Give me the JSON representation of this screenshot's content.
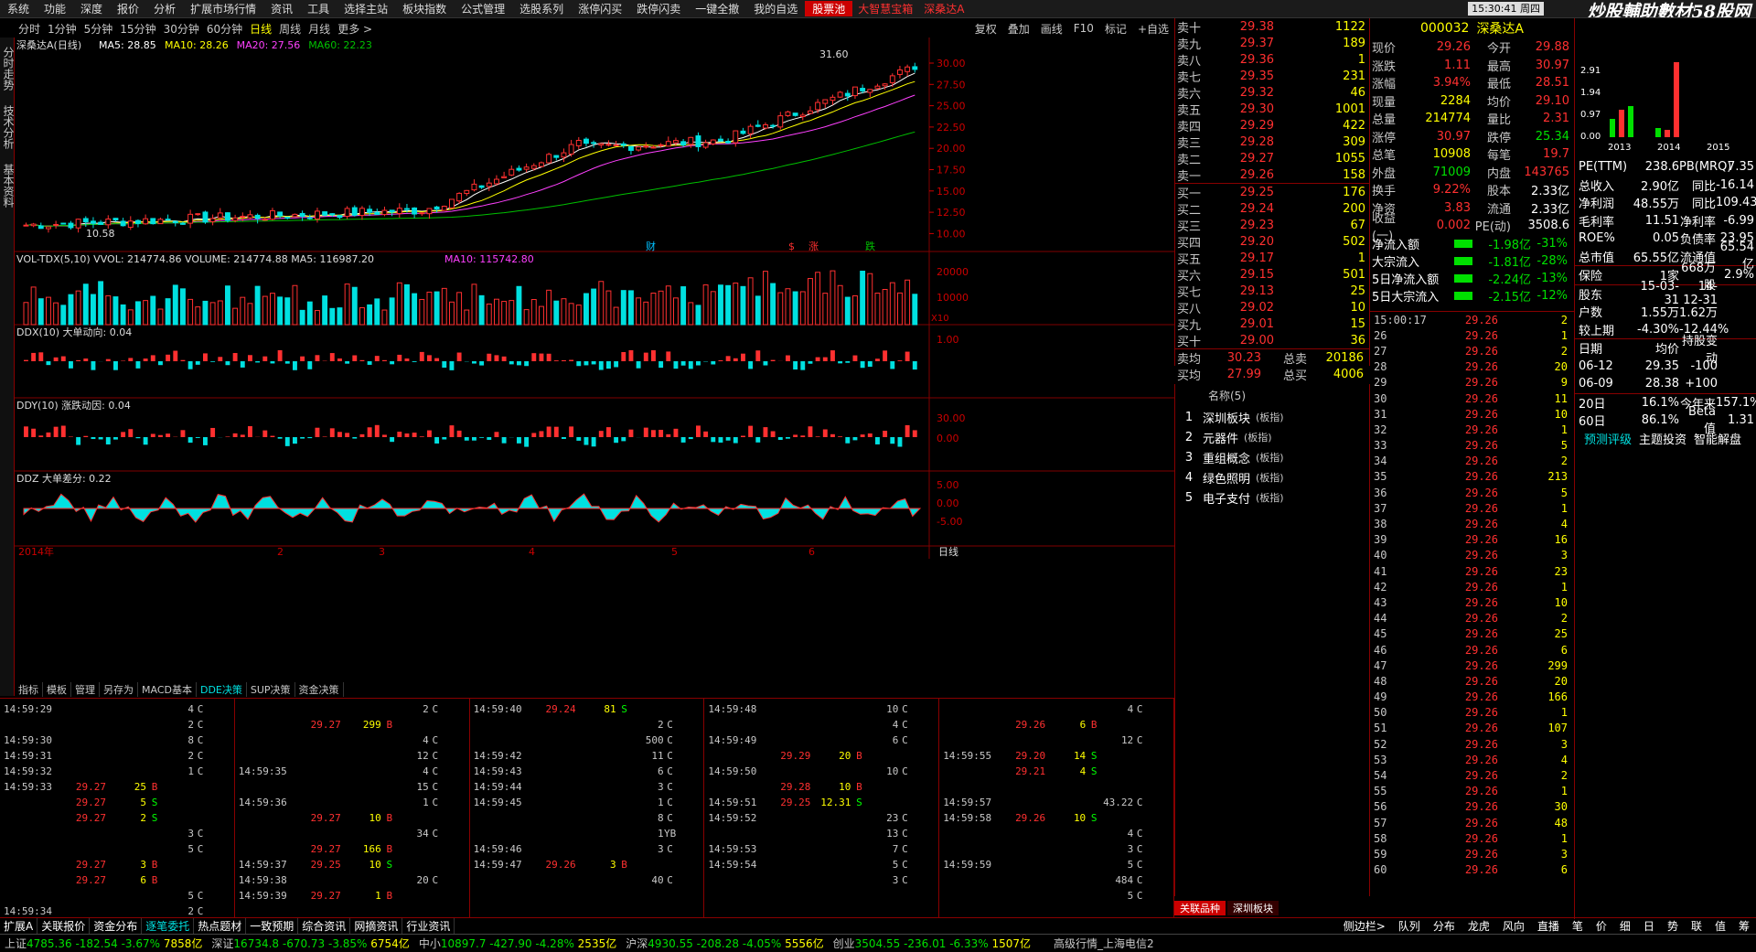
{
  "menu": {
    "items": [
      "系统",
      "功能",
      "深度",
      "报价",
      "分析",
      "扩展市场行情",
      "资讯",
      "工具",
      "选择主站",
      "板块指数",
      "公式管理",
      "选股系列",
      "涨停闪买",
      "跌停闪卖",
      "一键全撤",
      "我的自选",
      "股票池"
    ],
    "active": "股票池",
    "hot": [
      "大智慧宝箱",
      "深桑达A"
    ],
    "clock": "15:30:41 周四",
    "watermark": "炒股輔助數材58股网"
  },
  "periods": {
    "items": [
      "分时",
      "1分钟",
      "5分钟",
      "15分钟",
      "30分钟",
      "60分钟",
      "日线",
      "周线",
      "月线",
      "更多 >"
    ],
    "active": "日线",
    "tools": [
      "复权",
      "叠加",
      "画线",
      "F10",
      "标记",
      "+自选"
    ]
  },
  "sidebar": {
    "tabs": [
      "分时走势",
      "技术分析",
      "基本资料"
    ]
  },
  "chart": {
    "title": "深桑达A(日线)",
    "ma": [
      {
        "label": "MA5: 28.85",
        "color": "#ffffff"
      },
      {
        "label": "MA10: 28.26",
        "color": "#ffff00"
      },
      {
        "label": "MA20: 27.56",
        "color": "#ff40ff"
      },
      {
        "label": "MA60: 22.23",
        "color": "#00c000"
      }
    ],
    "high_label": "31.60",
    "low_label": "10.58",
    "price_ticks": [
      "30.00",
      "27.50",
      "25.00",
      "22.50",
      "20.00",
      "17.50",
      "15.00",
      "12.50",
      "10.00"
    ],
    "vol_title": "VOL-TDX(5,10) VVOL: 214774.86  VOLUME: 214774.88  MA5: 116987.20",
    "vol_ma10": "MA10: 115742.80",
    "vol_ticks": [
      "20000",
      "10000"
    ],
    "vol_unit": "X10",
    "ddx_title": "DDX(10) 大单动向: 0.04",
    "ddx_ticks": [
      "1.00"
    ],
    "ddy_title": "DDY(10) 涨跌动因: 0.04",
    "ddy_ticks": [
      "30.00",
      "0.00"
    ],
    "ddz_title": "DDZ 大单差分: 0.22",
    "ddz_ticks": [
      "5.00",
      "0.00",
      "-5.00"
    ],
    "date_labels": [
      "2014年",
      "2",
      "3",
      "4",
      "5",
      "6"
    ],
    "period_label": "日线",
    "markers": [
      "财",
      "$",
      "涨",
      "跌"
    ]
  },
  "chart_data": {
    "type": "candlestick",
    "series": [
      {
        "name": "MA5",
        "values": [
          28.85
        ]
      },
      {
        "name": "MA10",
        "values": [
          28.26
        ]
      },
      {
        "name": "MA20",
        "values": [
          27.56
        ]
      },
      {
        "name": "MA60",
        "values": [
          22.23
        ]
      }
    ],
    "ylim": [
      10,
      31.6
    ],
    "high": 31.6,
    "low": 10.58
  },
  "indicator_tabs": {
    "items": [
      "指标",
      "模板",
      "管理",
      "另存为",
      "MACD基本",
      "DDE决策",
      "SUP决策",
      "资金决策"
    ],
    "active": "DDE决策"
  },
  "ticks": [
    [
      [
        "14:59:29",
        "",
        "",
        "4",
        "C"
      ],
      [
        "",
        "",
        "",
        "2",
        "C"
      ],
      [
        "14:59:30",
        "",
        "",
        "8",
        "C"
      ],
      [
        "14:59:31",
        "",
        "",
        "2",
        "C"
      ],
      [
        "14:59:32",
        "",
        "",
        "1",
        "C"
      ],
      [
        "14:59:33",
        "29.27",
        "25",
        "B"
      ],
      [
        "",
        "29.27",
        "5",
        "S"
      ],
      [
        "",
        "29.27",
        "2",
        "S"
      ],
      [
        "",
        "",
        "",
        "3",
        "C"
      ],
      [
        "",
        "",
        "",
        "5",
        "C"
      ],
      [
        "",
        "29.27",
        "3",
        "B"
      ],
      [
        "",
        "29.27",
        "6",
        "B"
      ],
      [
        "",
        "",
        "",
        "5",
        "C"
      ],
      [
        "14:59:34",
        "",
        "",
        "2",
        "C"
      ]
    ],
    [
      [
        "",
        "",
        "",
        "2",
        "C"
      ],
      [
        "",
        "29.27",
        "299",
        "B"
      ],
      [
        "",
        "",
        "",
        "4",
        "C"
      ],
      [
        "",
        "",
        "",
        "12",
        "C"
      ],
      [
        "14:59:35",
        "",
        "",
        "4",
        "C"
      ],
      [
        "",
        "",
        "",
        "15",
        "C"
      ],
      [
        "14:59:36",
        "",
        "",
        "1",
        "C"
      ],
      [
        "",
        "29.27",
        "10",
        "B"
      ],
      [
        "",
        "",
        "",
        "34",
        "C"
      ],
      [
        "",
        "29.27",
        "166",
        "B"
      ],
      [
        "14:59:37",
        "29.25",
        "10",
        "S"
      ],
      [
        "14:59:38",
        "",
        "",
        "20",
        "C"
      ],
      [
        "14:59:39",
        "29.27",
        "1",
        "B"
      ],
      [
        "",
        "",
        "",
        ""
      ]
    ],
    [
      [
        "14:59:40",
        "29.24",
        "81",
        "S"
      ],
      [
        "",
        "",
        "",
        "2",
        "C"
      ],
      [
        "",
        "",
        "",
        "500",
        "C"
      ],
      [
        "14:59:42",
        "",
        "",
        "11",
        "C"
      ],
      [
        "14:59:43",
        "",
        "",
        "6",
        "C"
      ],
      [
        "14:59:44",
        "",
        "",
        "3",
        "C"
      ],
      [
        "14:59:45",
        "",
        "",
        "1",
        "C"
      ],
      [
        "",
        "",
        "",
        "8",
        "C"
      ],
      [
        "",
        "",
        "",
        "1",
        "YB"
      ],
      [
        "14:59:46",
        "",
        "",
        "3",
        "C"
      ],
      [
        "14:59:47",
        "29.26",
        "3",
        "B"
      ],
      [
        "",
        "",
        "",
        "40",
        "C"
      ],
      [
        "",
        "",
        "",
        ""
      ],
      [
        "",
        "",
        "",
        ""
      ]
    ],
    [
      [
        "14:59:48",
        "",
        "",
        "10",
        "C"
      ],
      [
        "",
        "",
        "",
        "4",
        "C"
      ],
      [
        "14:59:49",
        "",
        "",
        "6",
        "C"
      ],
      [
        "",
        "29.29",
        "20",
        "B"
      ],
      [
        "14:59:50",
        "",
        "",
        "10",
        "C"
      ],
      [
        "",
        "29.28",
        "10",
        "B"
      ],
      [
        "14:59:51",
        "29.25",
        "12.31",
        "S"
      ],
      [
        "14:59:52",
        "",
        "",
        "23",
        "C"
      ],
      [
        "",
        "",
        "",
        "13",
        "C"
      ],
      [
        "14:59:53",
        "",
        "",
        "7",
        "C"
      ],
      [
        "14:59:54",
        "",
        "",
        "5",
        "C"
      ],
      [
        "",
        "",
        "",
        "3",
        "C"
      ],
      [
        "",
        "",
        "",
        ""
      ],
      [
        "",
        "",
        "",
        ""
      ]
    ],
    [
      [
        "",
        "",
        "",
        "4",
        "C"
      ],
      [
        "",
        "29.26",
        "6",
        "B"
      ],
      [
        "",
        "",
        "",
        "12",
        "C"
      ],
      [
        "14:59:55",
        "29.20",
        "14",
        "S"
      ],
      [
        "",
        "29.21",
        "4",
        "S"
      ],
      [
        "",
        "",
        "",
        "",
        ""
      ],
      [
        "14:59:57",
        "",
        "",
        "43.22",
        "C"
      ],
      [
        "14:59:58",
        "29.26",
        "10",
        "S"
      ],
      [
        "",
        "",
        "",
        "4",
        "C"
      ],
      [
        "",
        "",
        "",
        "3",
        "C"
      ],
      [
        "14:59:59",
        "",
        "",
        "5",
        "C"
      ],
      [
        "",
        "",
        "",
        "484",
        "C"
      ],
      [
        "",
        "",
        "",
        "5",
        "C"
      ],
      [
        "",
        "",
        "",
        ""
      ]
    ]
  ],
  "quote": {
    "sell": [
      [
        "卖十",
        "29.38",
        "1122"
      ],
      [
        "卖九",
        "29.37",
        "189"
      ],
      [
        "卖八",
        "29.36",
        "1"
      ],
      [
        "卖七",
        "29.35",
        "231"
      ],
      [
        "卖六",
        "29.32",
        "46"
      ],
      [
        "卖五",
        "29.30",
        "1001"
      ],
      [
        "卖四",
        "29.29",
        "422"
      ],
      [
        "卖三",
        "29.28",
        "309"
      ],
      [
        "卖二",
        "29.27",
        "1055"
      ],
      [
        "卖一",
        "29.26",
        "158"
      ]
    ],
    "buy": [
      [
        "买一",
        "29.25",
        "176"
      ],
      [
        "买二",
        "29.24",
        "200"
      ],
      [
        "买三",
        "29.23",
        "67"
      ],
      [
        "买四",
        "29.20",
        "502"
      ],
      [
        "买五",
        "29.17",
        "1"
      ],
      [
        "买六",
        "29.15",
        "501"
      ],
      [
        "买七",
        "29.13",
        "25"
      ],
      [
        "买八",
        "29.02",
        "10"
      ],
      [
        "买九",
        "29.01",
        "15"
      ],
      [
        "买十",
        "29.00",
        "36"
      ]
    ],
    "sum": [
      {
        "l": "卖均",
        "v": "30.23",
        "l2": "总卖",
        "v2": "20186"
      },
      {
        "l": "买均",
        "v": "27.99",
        "l2": "总买",
        "v2": "4006"
      }
    ]
  },
  "related": {
    "header": "名称(5)",
    "items": [
      {
        "n": "1",
        "name": "深圳板块",
        "tag": "(板指)"
      },
      {
        "n": "2",
        "name": "元器件",
        "tag": "(板指)"
      },
      {
        "n": "3",
        "name": "重组概念",
        "tag": "(板指)"
      },
      {
        "n": "4",
        "name": "绿色照明",
        "tag": "(板指)"
      },
      {
        "n": "5",
        "name": "电子支付",
        "tag": "(板指)"
      }
    ],
    "tabs": [
      "关联品种",
      "深圳板块"
    ]
  },
  "info": {
    "code": "000032",
    "name": "深桑达A",
    "rows": [
      [
        "现价",
        "29.26",
        "今开",
        "29.88"
      ],
      [
        "涨跌",
        "1.11",
        "最高",
        "30.97"
      ],
      [
        "涨幅",
        "3.94%",
        "最低",
        "28.51"
      ],
      [
        "现量",
        "2284",
        "均价",
        "29.10"
      ],
      [
        "总量",
        "214774",
        "量比",
        "2.31"
      ],
      [
        "涨停",
        "30.97",
        "跌停",
        "25.34"
      ],
      [
        "总笔",
        "10908",
        "每笔",
        "19.7"
      ],
      [
        "外盘",
        "71009",
        "内盘",
        "143765"
      ],
      [
        "换手",
        "9.22%",
        "股本",
        "2.33亿"
      ],
      [
        "净资",
        "3.83",
        "流通",
        "2.33亿"
      ],
      [
        "收益(一)",
        "0.002",
        "PE(动)",
        "3508.6"
      ]
    ],
    "flow": [
      [
        "净流入额",
        "-1.98亿",
        "-31%"
      ],
      [
        "大宗流入",
        "-1.81亿",
        "-28%"
      ],
      [
        "5日净流入额",
        "-2.24亿",
        "-13%"
      ],
      [
        "5日大宗流入",
        "-2.15亿",
        "-12%"
      ]
    ]
  },
  "minute": {
    "start": "15:00:17",
    "rows": [
      [
        "15:00:17",
        "29.26",
        "2"
      ],
      [
        "26",
        "29.26",
        "1"
      ],
      [
        "27",
        "29.26",
        "2"
      ],
      [
        "28",
        "29.26",
        "20"
      ],
      [
        "29",
        "29.26",
        "9"
      ],
      [
        "30",
        "29.26",
        "11"
      ],
      [
        "31",
        "29.26",
        "10"
      ],
      [
        "32",
        "29.26",
        "1"
      ],
      [
        "33",
        "29.26",
        "5"
      ],
      [
        "34",
        "29.26",
        "2"
      ],
      [
        "35",
        "29.26",
        "213"
      ],
      [
        "36",
        "29.26",
        "5"
      ],
      [
        "37",
        "29.26",
        "1"
      ],
      [
        "38",
        "29.26",
        "4"
      ],
      [
        "39",
        "29.26",
        "16"
      ],
      [
        "40",
        "29.26",
        "3"
      ],
      [
        "41",
        "29.26",
        "23"
      ],
      [
        "42",
        "29.26",
        "1"
      ],
      [
        "43",
        "29.26",
        "10"
      ],
      [
        "44",
        "29.26",
        "2"
      ],
      [
        "45",
        "29.26",
        "25"
      ],
      [
        "46",
        "29.26",
        "6"
      ],
      [
        "47",
        "29.26",
        "299"
      ],
      [
        "48",
        "29.26",
        "20"
      ],
      [
        "49",
        "29.26",
        "166"
      ],
      [
        "50",
        "29.26",
        "1"
      ],
      [
        "51",
        "29.26",
        "107"
      ],
      [
        "52",
        "29.26",
        "3"
      ],
      [
        "53",
        "29.26",
        "4"
      ],
      [
        "54",
        "29.26",
        "2"
      ],
      [
        "55",
        "29.26",
        "1"
      ],
      [
        "56",
        "29.26",
        "30"
      ],
      [
        "57",
        "29.26",
        "48"
      ],
      [
        "58",
        "29.26",
        "1"
      ],
      [
        "59",
        "29.26",
        "3"
      ],
      [
        "60",
        "29.26",
        "6"
      ]
    ]
  },
  "fin": {
    "years": [
      "2013",
      "2014",
      "2015"
    ],
    "bar_ticks": [
      "2.91",
      "1.94",
      "0.97",
      "0.00"
    ],
    "rows": [
      [
        "PE(TTM)",
        "238.6",
        "PB(MRQ)",
        "7.35"
      ],
      [
        "总收入",
        "2.90亿",
        "同比",
        "-16.14"
      ],
      [
        "净利润",
        "48.55万",
        "同比",
        "109.43"
      ],
      [
        "毛利率",
        "11.51",
        "净利率",
        "-6.99"
      ],
      [
        "ROE%",
        "0.05",
        "负债率",
        "23.95"
      ],
      [
        "总市值",
        "65.55亿",
        "流通值",
        "65.54亿"
      ]
    ],
    "insurance": [
      "保险",
      "1家",
      "668万股",
      "2.9%"
    ],
    "holders": [
      [
        "股东",
        "15-03-31",
        "14-12-31"
      ],
      [
        "户数",
        "1.55万",
        "1.62万"
      ],
      [
        "较上期",
        "-4.30%",
        "-12.44%"
      ]
    ],
    "avg_header": [
      "日期",
      "均价",
      "持股变动"
    ],
    "avg": [
      [
        "06-12",
        "29.35",
        "-100"
      ],
      [
        "06-09",
        "28.38",
        "+100"
      ]
    ],
    "ret": [
      [
        "20日",
        "16.1%",
        "今年来",
        "157.1%"
      ],
      [
        "60日",
        "86.1%",
        "Beta值",
        "1.31"
      ]
    ],
    "links": [
      "预测评级",
      "主题投资",
      "智能解盘"
    ]
  },
  "bottom_tabs": {
    "items": [
      "扩展A",
      "关联报价",
      "资金分布",
      "逐笔委托",
      "热点题材",
      "一致预期",
      "综合资讯",
      "网摘资讯",
      "行业资讯"
    ],
    "active": "逐笔委托",
    "right": [
      "队列",
      "分布",
      "龙虎",
      "风向",
      "直播",
      "笔",
      "价",
      "细",
      "日",
      "势",
      "联",
      "值",
      "筹"
    ],
    "side_label": "侧边栏>"
  },
  "status": {
    "indices": [
      [
        "上证",
        "4785.36",
        "-182.54",
        "-3.67%",
        "7858亿"
      ],
      [
        "深证",
        "16734.8",
        "-670.73",
        "-3.85%",
        "6754亿"
      ],
      [
        "中小",
        "10897.7",
        "-427.90",
        "-4.28%",
        "2535亿"
      ],
      [
        "沪深",
        "4930.55",
        "-208.28",
        "-4.05%",
        "5556亿"
      ],
      [
        "创业",
        "3504.55",
        "-236.01",
        "-6.33%",
        "1507亿"
      ]
    ],
    "conn": "高级行情_上海电信2"
  },
  "colors": {
    "up": "#ff3030",
    "down": "#00e0e0",
    "ma5": "#ffffff",
    "ma10": "#ffff00",
    "ma20": "#ff40ff",
    "ma60": "#00c000",
    "grid": "#800000"
  }
}
